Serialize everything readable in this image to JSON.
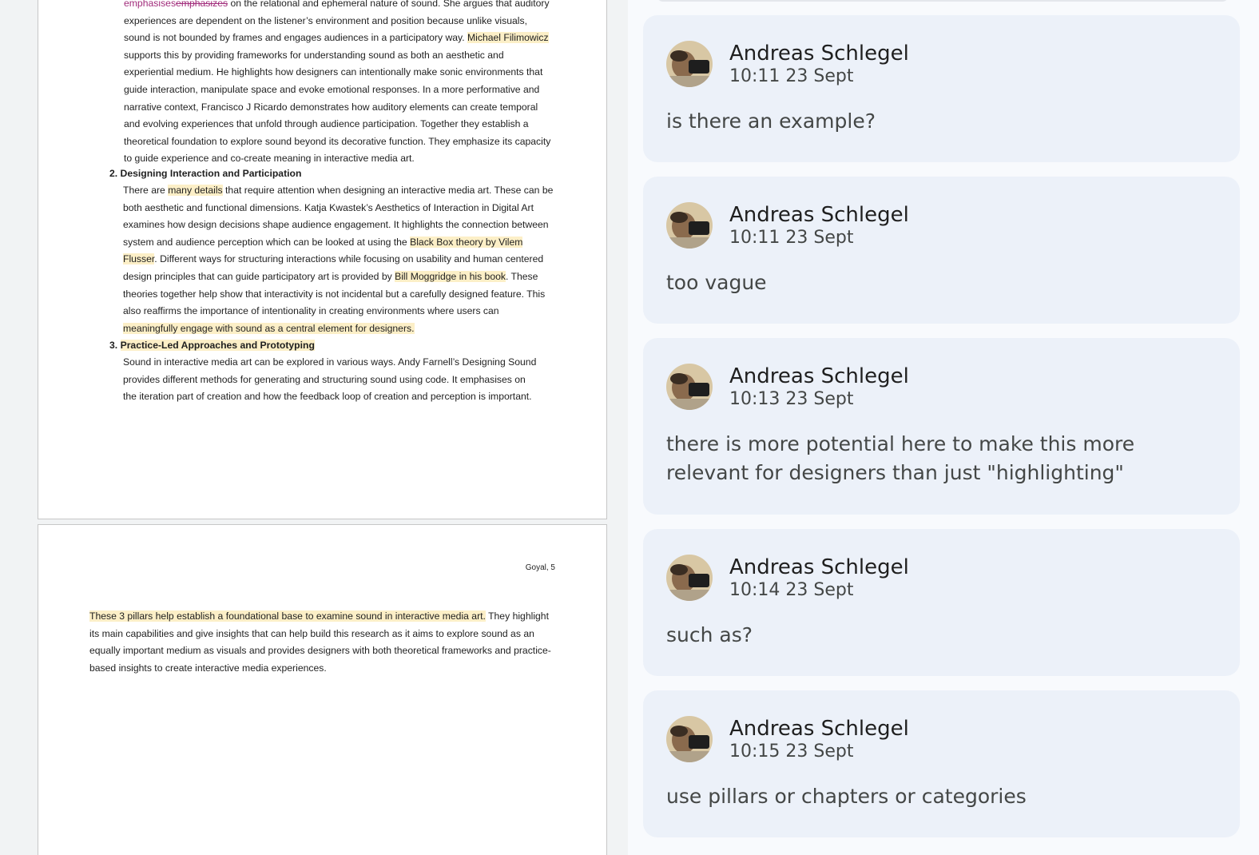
{
  "document": {
    "page1": {
      "p1_ins": "emphasises",
      "p1_del": "emphasizes",
      "p1_a": " on the relational and ephemeral nature of sound. She argues that auditory experiences are dependent on the listener’s environment and position because unlike visuals, sound is not bounded by frames and engages audiences in a participatory way. ",
      "p1_hl": "Michael Filimowicz",
      "p1_b": " supports this by providing frameworks for understanding sound as both an aesthetic and experiential medium. He highlights how designers can intentionally make sonic environments that guide interaction, manipulate space and evoke emotional responses. In a more performative and narrative context, Francisco J Ricardo demonstrates how auditory elements can create temporal and evolving experiences that unfold through audience participation. Together they establish a theoretical foundation to explore sound beyond its decorative function. They emphasize its capacity to guide experience and co-create meaning in interactive media art.",
      "heading2": "2. Designing Interaction and Participation",
      "p2_a": "There are ",
      "p2_hl1": "many details",
      "p2_b": " that require attention when designing an interactive media art. These can be both aesthetic and functional dimensions. Katja Kwastek’s Aesthetics of Interaction in Digital Art examines how design decisions shape audience engagement. It highlights the connection between system and audience perception which can be looked at using the ",
      "p2_hl2": "Black Box theory by Vilem Flusser",
      "p2_c": ". Different ways for structuring interactions while focusing on usability and human centered design principles that can guide participatory art is provided by ",
      "p2_hl3": "Bill Moggridge in his book",
      "p2_d": ". These theories together help show that interactivity is not incidental but a carefully designed feature. This also reaffirms the importance of intentionality in creating environments where users can ",
      "p2_hl4": "meaningfully engage with sound as a central element for designers.",
      "heading3_num": "3. ",
      "heading3": "Practice-Led Approaches and Prototyping",
      "p3": "Sound in interactive media art can be explored in various ways. Andy Farnell’s Designing Sound provides different methods for generating and structuring sound using code. It emphasises on the iteration part of creation and how the feedback loop of creation and perception is important."
    },
    "page2": {
      "header": "Goyal, 5",
      "p4_hl": "These 3 pillars help establish a foundational base to examine sound in interactive media art.",
      "p4_rest": " They highlight its main capabilities and give insights that can help build this research as it aims to explore sound as an equally important medium as visuals and provides designers with both theoretical frameworks and practice-based insights to create interactive media experiences."
    }
  },
  "comments": [
    {
      "author": "Andreas Schlegel",
      "time": "10:11 23 Sept",
      "text": "is there an example?"
    },
    {
      "author": "Andreas Schlegel",
      "time": "10:11 23 Sept",
      "text": "too vague"
    },
    {
      "author": "Andreas Schlegel",
      "time": "10:13 23 Sept",
      "text": "there is more potential here to make this more relevant for designers than just \"highlighting\""
    },
    {
      "author": "Andreas Schlegel",
      "time": "10:14 23 Sept",
      "text": "such as?"
    },
    {
      "author": "Andreas Schlegel",
      "time": "10:15 23 Sept",
      "text": "use pillars or chapters or categories"
    }
  ],
  "colors": {
    "highlight": "#fcefc7",
    "suggestion": "#a12c7b",
    "card": "#ecf1f9"
  }
}
